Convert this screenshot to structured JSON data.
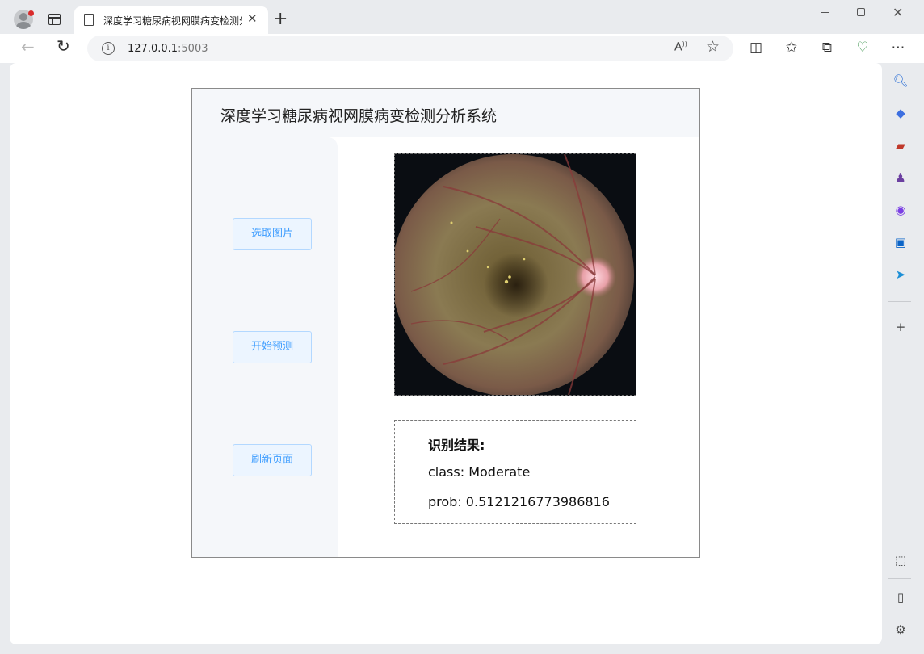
{
  "browser": {
    "tab_title": "深度学习糖尿病视网膜病变检测分析系统",
    "url_host": "127.0.0.1",
    "url_port": ":5003"
  },
  "app": {
    "title": "深度学习糖尿病视网膜病变检测分析系统",
    "buttons": {
      "select_image": "选取图片",
      "start_predict": "开始预测",
      "refresh_page": "刷新页面"
    },
    "result": {
      "heading": "识别结果:",
      "class_line": "class: Moderate",
      "prob_line": "prob: 0.5121216773986816"
    }
  },
  "icons": {
    "accent": "#409eff",
    "button_bg": "#ecf5ff",
    "button_border": "#b3d8ff"
  }
}
